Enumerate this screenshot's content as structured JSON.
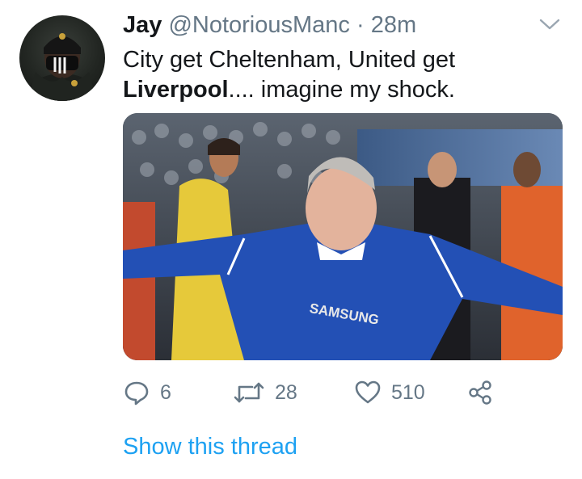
{
  "tweet": {
    "display_name": "Jay",
    "handle": "@NotoriousManc",
    "separator": "·",
    "time": "28m",
    "text_part1": "City get Cheltenham, United get ",
    "text_bold": "Liverpool",
    "text_part2": ".... imagine my shock."
  },
  "media": {
    "shirt_text": "SAMSUNG"
  },
  "actions": {
    "reply_count": "6",
    "retweet_count": "28",
    "like_count": "510"
  },
  "thread_link": "Show this thread",
  "icons": {
    "menu": "chevron-down-icon",
    "reply": "reply-icon",
    "retweet": "retweet-icon",
    "like": "heart-icon",
    "share": "share-icon"
  },
  "colors": {
    "link": "#1da1f2",
    "secondary_text": "#657786",
    "primary_text": "#14171a"
  }
}
